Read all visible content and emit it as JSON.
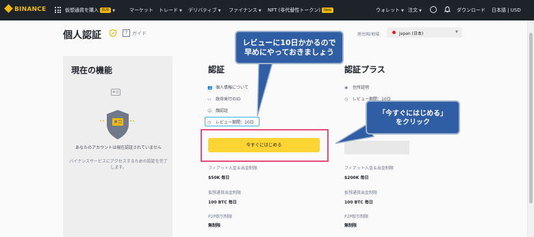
{
  "topbar": {
    "logo": "BINANCE",
    "nav": [
      {
        "label": "仮想通貨を購入",
        "badge": "EUR",
        "chevron": true
      },
      {
        "label": "マーケット",
        "chevron": false
      },
      {
        "label": "トレード",
        "chevron": true
      },
      {
        "label": "デリバティブ",
        "chevron": true
      },
      {
        "label": "ファイナンス",
        "chevron": true
      },
      {
        "label": "NFT (非代替性トークン)",
        "badge": "New",
        "chevron": false
      }
    ],
    "right": {
      "wallet": "ウォレット",
      "orders": "注文",
      "download": "ダウンロード",
      "lang_currency": "日本語 | USD"
    }
  },
  "header": {
    "title": "個人認証",
    "guide_icon": "?",
    "guide": "ガイド",
    "country_label": "居住国/地域:",
    "country_value": "Japan (日本)"
  },
  "current": {
    "heading": "現在の機能",
    "message": "あなたのアカウントは現在認証されていません",
    "sub": "バイナンスサービスにアクセスするための認証を完了します。"
  },
  "verify": {
    "heading": "認証",
    "features": [
      {
        "icon": "person-icon",
        "label": "個人情報について"
      },
      {
        "icon": "id-card-icon",
        "label": "政府発行のID"
      },
      {
        "icon": "face-icon",
        "label": "顔認証"
      },
      {
        "icon": "clock-icon",
        "label": "レビュー期間：10日"
      }
    ],
    "cta": "今すぐにはじめる",
    "limits": [
      {
        "label": "フィアット入金＆出金制限",
        "value": "$50K 毎日"
      },
      {
        "label": "仮想通貨出金制限",
        "value": "100 BTC 毎日"
      },
      {
        "label": "P2P取引制限",
        "value": "無制限"
      }
    ]
  },
  "verify_plus": {
    "heading": "認証プラス",
    "features": [
      {
        "icon": "location-icon",
        "label": "住所証明"
      },
      {
        "icon": "clock-icon",
        "label": "レビュー期間：10日"
      }
    ],
    "limits": [
      {
        "label": "フィアット入金＆出金制限",
        "value": "$200K 毎日"
      },
      {
        "label": "仮想通貨出金制限",
        "value": "100 BTC 毎日"
      },
      {
        "label": "P2P取引制限",
        "value": "無制限"
      }
    ]
  },
  "annotations": {
    "bubble1_line1": "レビューに10日かかるので",
    "bubble1_line2": "早めにやっておきましょう",
    "bubble2_line1": "「今すぐにはじめる」",
    "bubble2_line2": "をクリック"
  },
  "colors": {
    "accent": "#fcd535",
    "topbar": "#1e2329",
    "highlight_outline": "#e64b7a",
    "review_outline": "#3ab5e8",
    "callout": "#2f5ea5"
  }
}
